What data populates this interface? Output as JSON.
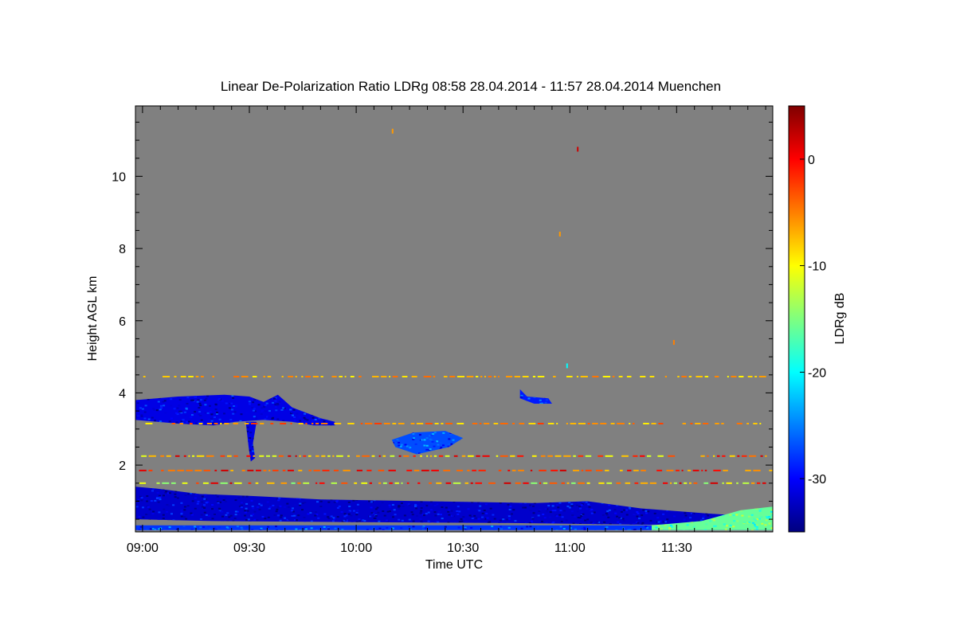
{
  "chart_data": {
    "type": "heatmap",
    "title": "Linear De-Polarization Ratio LDRg   08:58 28.04.2014 - 11:57 28.04.2014 Muenchen",
    "xlabel": "Time UTC",
    "ylabel": "Height AGL km",
    "colorbar_label": "LDRg dB",
    "x_unit": "minutes of day (UTC)",
    "xlim": [
      538,
      717
    ],
    "ylim": [
      0.15,
      11.95
    ],
    "clim": [
      -35,
      5
    ],
    "x_ticks": [
      {
        "value": 540,
        "label": "09:00"
      },
      {
        "value": 570,
        "label": "09:30"
      },
      {
        "value": 600,
        "label": "10:00"
      },
      {
        "value": 630,
        "label": "10:30"
      },
      {
        "value": 660,
        "label": "11:00"
      },
      {
        "value": 690,
        "label": "11:30"
      }
    ],
    "y_ticks": [
      {
        "value": 2,
        "label": "2"
      },
      {
        "value": 4,
        "label": "4"
      },
      {
        "value": 6,
        "label": "6"
      },
      {
        "value": 8,
        "label": "8"
      },
      {
        "value": 10,
        "label": "10"
      }
    ],
    "colorbar_ticks": [
      {
        "value": 0,
        "label": "0"
      },
      {
        "value": -10,
        "label": "-10"
      },
      {
        "value": -20,
        "label": "-20"
      },
      {
        "value": -30,
        "label": "-30"
      }
    ],
    "background_color": "#808080",
    "colormap": [
      "#00007f",
      "#0000ff",
      "#007fff",
      "#00ffff",
      "#7fff7f",
      "#ffff00",
      "#ff7f00",
      "#ff0000",
      "#7f0000"
    ],
    "features": [
      {
        "name": "cloud layer 3.5 km",
        "ldr": -31,
        "outline": [
          [
            538,
            3.8
          ],
          [
            550,
            3.9
          ],
          [
            563,
            3.95
          ],
          [
            570,
            3.9
          ],
          [
            574,
            3.75
          ],
          [
            578,
            3.95
          ],
          [
            582,
            3.6
          ],
          [
            590,
            3.3
          ],
          [
            594,
            3.2
          ],
          [
            594,
            3.1
          ],
          [
            588,
            3.1
          ],
          [
            582,
            3.2
          ],
          [
            574,
            3.25
          ],
          [
            566,
            3.2
          ],
          [
            560,
            3.1
          ],
          [
            550,
            3.15
          ],
          [
            538,
            3.25
          ]
        ]
      },
      {
        "name": "fall streak",
        "ldr": -31,
        "outline": [
          [
            569,
            3.2
          ],
          [
            572,
            3.2
          ],
          [
            571,
            2.6
          ],
          [
            571.6,
            2.2
          ],
          [
            570.4,
            2.1
          ],
          [
            569.8,
            2.5
          ]
        ]
      },
      {
        "name": "cloud 10:20",
        "ldr": -27,
        "outline": [
          [
            610,
            2.7
          ],
          [
            616,
            2.9
          ],
          [
            625,
            2.95
          ],
          [
            630,
            2.75
          ],
          [
            626,
            2.5
          ],
          [
            617,
            2.3
          ],
          [
            611,
            2.5
          ]
        ]
      },
      {
        "name": "cloud 10:50",
        "ldr": -29,
        "outline": [
          [
            646,
            4.1
          ],
          [
            648,
            3.9
          ],
          [
            654,
            3.85
          ],
          [
            655,
            3.7
          ],
          [
            650,
            3.7
          ],
          [
            646,
            3.85
          ]
        ]
      },
      {
        "name": "boundary layer",
        "ldr": -32,
        "outline": [
          [
            538,
            1.4
          ],
          [
            544,
            1.35
          ],
          [
            556,
            1.2
          ],
          [
            570,
            1.15
          ],
          [
            590,
            1.05
          ],
          [
            620,
            1.0
          ],
          [
            650,
            0.95
          ],
          [
            665,
            1.0
          ],
          [
            680,
            0.8
          ],
          [
            700,
            0.65
          ],
          [
            717,
            0.55
          ],
          [
            717,
            0.35
          ],
          [
            680,
            0.35
          ],
          [
            640,
            0.4
          ],
          [
            600,
            0.42
          ],
          [
            560,
            0.45
          ],
          [
            538,
            0.5
          ]
        ]
      },
      {
        "name": "surface layer",
        "ldr": -28,
        "outline": [
          [
            538,
            0.33
          ],
          [
            717,
            0.33
          ],
          [
            717,
            0.2
          ],
          [
            538,
            0.2
          ]
        ]
      },
      {
        "name": "aerosol 11:40",
        "ldr": -16,
        "outline": [
          [
            683,
            0.33
          ],
          [
            697,
            0.45
          ],
          [
            708,
            0.75
          ],
          [
            717,
            0.85
          ],
          [
            717,
            0.2
          ],
          [
            683,
            0.2
          ]
        ]
      }
    ],
    "echo_rows": [
      {
        "height": 2.25,
        "ldr_range": [
          -12,
          2
        ]
      },
      {
        "height": 1.85,
        "ldr_range": [
          -8,
          2
        ]
      },
      {
        "height": 1.5,
        "ldr_range": [
          -15,
          2
        ]
      },
      {
        "height": 3.15,
        "ldr_range": [
          -10,
          -2
        ]
      },
      {
        "height": 4.45,
        "ldr_range": [
          -10,
          -4
        ]
      }
    ],
    "isolated_points": [
      {
        "x": 610,
        "y": 11.25,
        "ldr": -6
      },
      {
        "x": 662,
        "y": 10.75,
        "ldr": 2
      },
      {
        "x": 657,
        "y": 8.4,
        "ldr": -6
      },
      {
        "x": 689,
        "y": 5.4,
        "ldr": -5
      },
      {
        "x": 659,
        "y": 4.75,
        "ldr": -20
      }
    ]
  }
}
